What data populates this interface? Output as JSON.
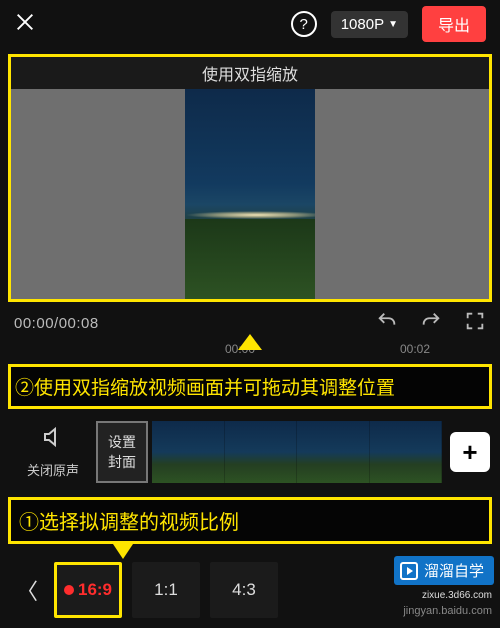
{
  "topbar": {
    "resolution_label": "1080P",
    "export_label": "导出"
  },
  "preview": {
    "hint": "使用双指缩放"
  },
  "playback": {
    "time_display": "00:00/00:08"
  },
  "ruler": {
    "tick0": "00:00",
    "tick1": "00:02"
  },
  "annotations": {
    "step2": "②使用双指缩放视频画面并可拖动其调整位置",
    "step1": "①选择拟调整的视频比例"
  },
  "audio": {
    "mute_label": "关闭原声"
  },
  "cover": {
    "line1": "设置",
    "line2": "封面"
  },
  "add_label": "+",
  "ratios": {
    "r0": "16:9",
    "r1": "1:1",
    "r2": "4:3"
  },
  "watermark": {
    "brand": "溜溜自学",
    "domain": "zixue.3d66.com",
    "source": "jingyan.baidu.com"
  }
}
